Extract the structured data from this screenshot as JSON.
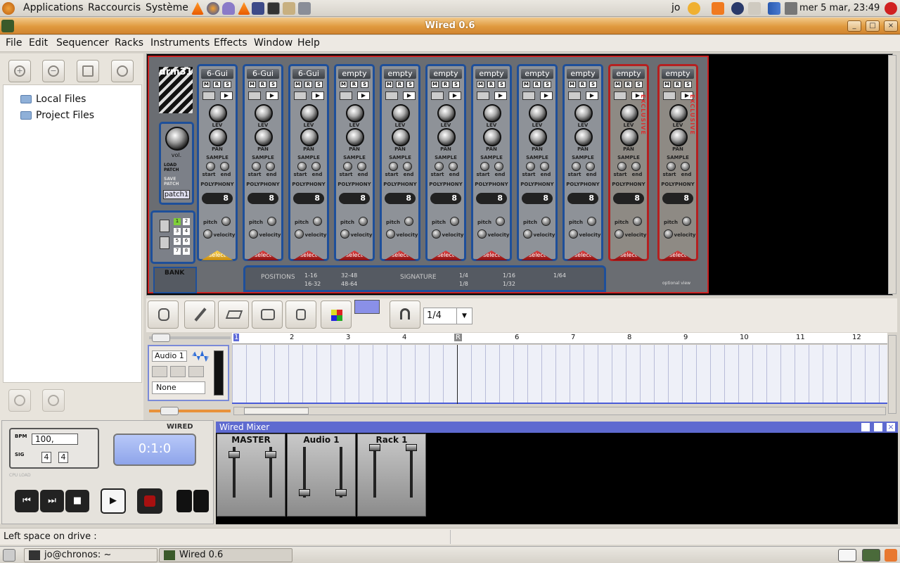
{
  "top_panel": {
    "applications": "Applications",
    "shortcuts": "Raccourcis",
    "system": "Système",
    "user": "jo",
    "datetime": "mer  5 mar, 23:49"
  },
  "window": {
    "title": "Wired 0.6"
  },
  "menu": [
    "File",
    "Edit",
    "Sequencer",
    "Racks",
    "Instruments",
    "Effects",
    "Window",
    "Help"
  ],
  "tree": [
    {
      "label": "Local Files"
    },
    {
      "label": "Project Files"
    }
  ],
  "rack": {
    "logo_text": "drm31",
    "vol_label": "vol.",
    "load_patch": "LOAD PATCH",
    "save_patch": "SAVE PATCH",
    "patch_name": "patch1",
    "bank_label": "BANK",
    "pad_numbers": [
      "1",
      "2",
      "3",
      "4",
      "5",
      "6",
      "7",
      "8"
    ],
    "strips": [
      {
        "name": "6-Gui",
        "exclusive": false
      },
      {
        "name": "6-Gui",
        "exclusive": false
      },
      {
        "name": "6-Gui",
        "exclusive": false
      },
      {
        "name": "empty",
        "exclusive": false
      },
      {
        "name": "empty",
        "exclusive": false
      },
      {
        "name": "empty",
        "exclusive": false
      },
      {
        "name": "empty",
        "exclusive": false
      },
      {
        "name": "empty",
        "exclusive": false
      },
      {
        "name": "empty",
        "exclusive": false
      },
      {
        "name": "empty",
        "exclusive": true
      },
      {
        "name": "empty",
        "exclusive": true
      }
    ],
    "strip_labels": {
      "m": "M",
      "r": "R",
      "s": "S",
      "lev": "LEV",
      "pan": "PAN",
      "sample": "SAMPLE",
      "start": "start",
      "end": "end",
      "polyphony": "POLYPHONY",
      "poly_value": "8",
      "pitch": "pitch",
      "velocity": "velocity",
      "select": "select",
      "exclusive": "EXCLUSIVE"
    },
    "positions_label": "POSITIONS",
    "positions": [
      "1-16",
      "32-48",
      "16-32",
      "48-64"
    ],
    "signature_label": "SIGNATURE",
    "signatures": [
      "1/4",
      "1/16",
      "1/64",
      "1/8",
      "1/32"
    ],
    "optional_view": "optional view"
  },
  "seq_toolbar": {
    "quantize": "1/4"
  },
  "sequencer": {
    "bars": [
      "1",
      "2",
      "3",
      "4",
      "R",
      "6",
      "7",
      "8",
      "9",
      "10",
      "11",
      "12"
    ],
    "track": {
      "name": "Audio 1",
      "input": "None"
    }
  },
  "transport": {
    "brand": "WIRED",
    "bpm_label": "BPM",
    "bpm": "100,",
    "sig_label": "SIG",
    "sig_num": "4",
    "sig_den": "4",
    "time": "0:1:0",
    "cpu_label": "CPU LOAD"
  },
  "mixer": {
    "title": "Wired Mixer",
    "channels": [
      "MASTER",
      "Audio 1",
      "Rack 1"
    ]
  },
  "status": {
    "text": "Left space on drive :"
  },
  "taskbar": [
    {
      "label": "jo@chronos: ~"
    },
    {
      "label": "Wired 0.6"
    }
  ]
}
